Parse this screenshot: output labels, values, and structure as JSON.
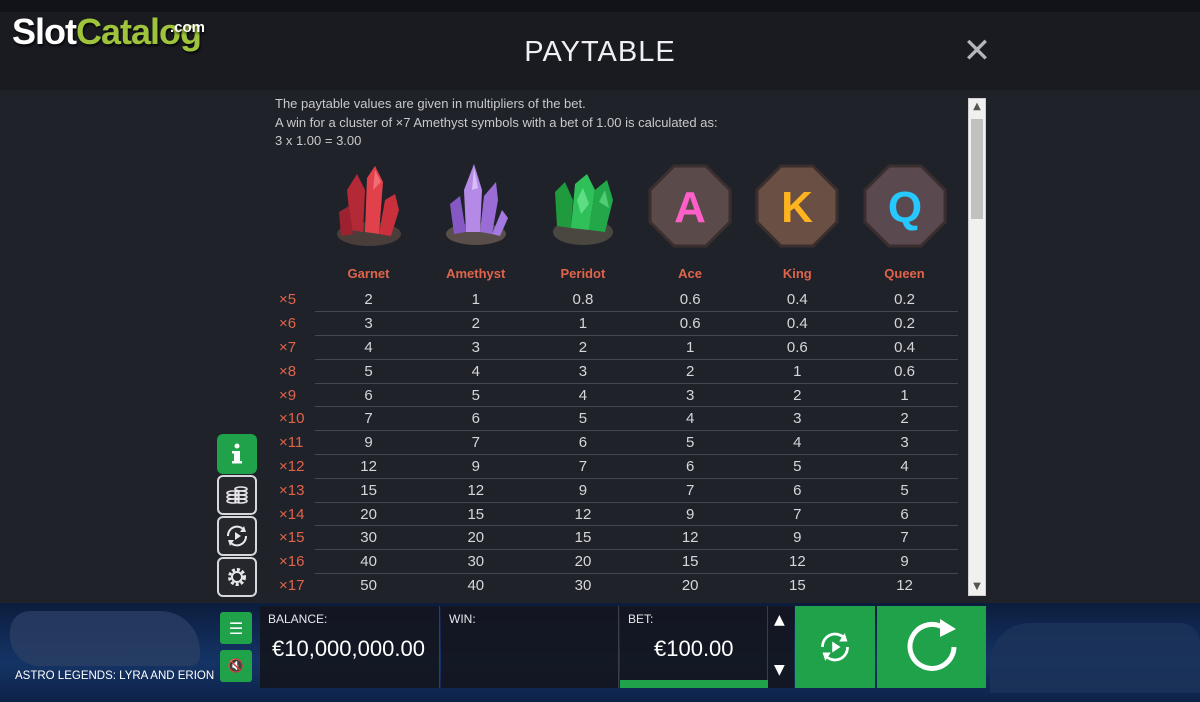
{
  "brand": {
    "name_part1": "Slot",
    "name_part2": "Catalog",
    "suffix": ".com"
  },
  "header": {
    "title": "PAYTABLE",
    "close_label": "✕"
  },
  "intro": [
    "The paytable values are given in multipliers of the bet.",
    "A win for a cluster of ×7 Amethyst symbols with a bet of 1.00 is calculated as:",
    "3 x 1.00 = 3.00"
  ],
  "symbols": [
    {
      "name": "Garnet",
      "icon": "garnet-crystal-icon",
      "color": "#d83a3a"
    },
    {
      "name": "Amethyst",
      "icon": "amethyst-crystal-icon",
      "color": "#b086e0"
    },
    {
      "name": "Peridot",
      "icon": "peridot-crystal-icon",
      "color": "#27b04a"
    },
    {
      "name": "Ace",
      "icon": "ace-rune-icon",
      "letter": "A",
      "color": "#ff5fc8"
    },
    {
      "name": "King",
      "icon": "king-rune-icon",
      "letter": "K",
      "color": "#ffb31f"
    },
    {
      "name": "Queen",
      "icon": "queen-rune-icon",
      "letter": "Q",
      "color": "#27c8ff"
    }
  ],
  "paytable": {
    "rows": [
      {
        "cluster": "×5",
        "values": [
          "2",
          "1",
          "0.8",
          "0.6",
          "0.4",
          "0.2"
        ]
      },
      {
        "cluster": "×6",
        "values": [
          "3",
          "2",
          "1",
          "0.6",
          "0.4",
          "0.2"
        ]
      },
      {
        "cluster": "×7",
        "values": [
          "4",
          "3",
          "2",
          "1",
          "0.6",
          "0.4"
        ]
      },
      {
        "cluster": "×8",
        "values": [
          "5",
          "4",
          "3",
          "2",
          "1",
          "0.6"
        ]
      },
      {
        "cluster": "×9",
        "values": [
          "6",
          "5",
          "4",
          "3",
          "2",
          "1"
        ]
      },
      {
        "cluster": "×10",
        "values": [
          "7",
          "6",
          "5",
          "4",
          "3",
          "2"
        ]
      },
      {
        "cluster": "×11",
        "values": [
          "9",
          "7",
          "6",
          "5",
          "4",
          "3"
        ]
      },
      {
        "cluster": "×12",
        "values": [
          "12",
          "9",
          "7",
          "6",
          "5",
          "4"
        ]
      },
      {
        "cluster": "×13",
        "values": [
          "15",
          "12",
          "9",
          "7",
          "6",
          "5"
        ]
      },
      {
        "cluster": "×14",
        "values": [
          "20",
          "15",
          "12",
          "9",
          "7",
          "6"
        ]
      },
      {
        "cluster": "×15",
        "values": [
          "30",
          "20",
          "15",
          "12",
          "9",
          "7"
        ]
      },
      {
        "cluster": "×16",
        "values": [
          "40",
          "30",
          "20",
          "15",
          "12",
          "9"
        ]
      },
      {
        "cluster": "×17",
        "values": [
          "50",
          "40",
          "30",
          "20",
          "15",
          "12"
        ]
      }
    ]
  },
  "side_buttons": [
    "info-icon",
    "coins-icon",
    "autoplay-icon",
    "settings-icon"
  ],
  "footer": {
    "game_title": "ASTRO LEGENDS: LYRA AND ERION",
    "balance_label": "BALANCE:",
    "balance_value": "€10,000,000.00",
    "win_label": "WIN:",
    "win_value": "",
    "bet_label": "BET:",
    "bet_value": "€100.00"
  },
  "colors": {
    "accent": "#1fa24a",
    "label": "#e0644a",
    "background": "#20222a"
  }
}
